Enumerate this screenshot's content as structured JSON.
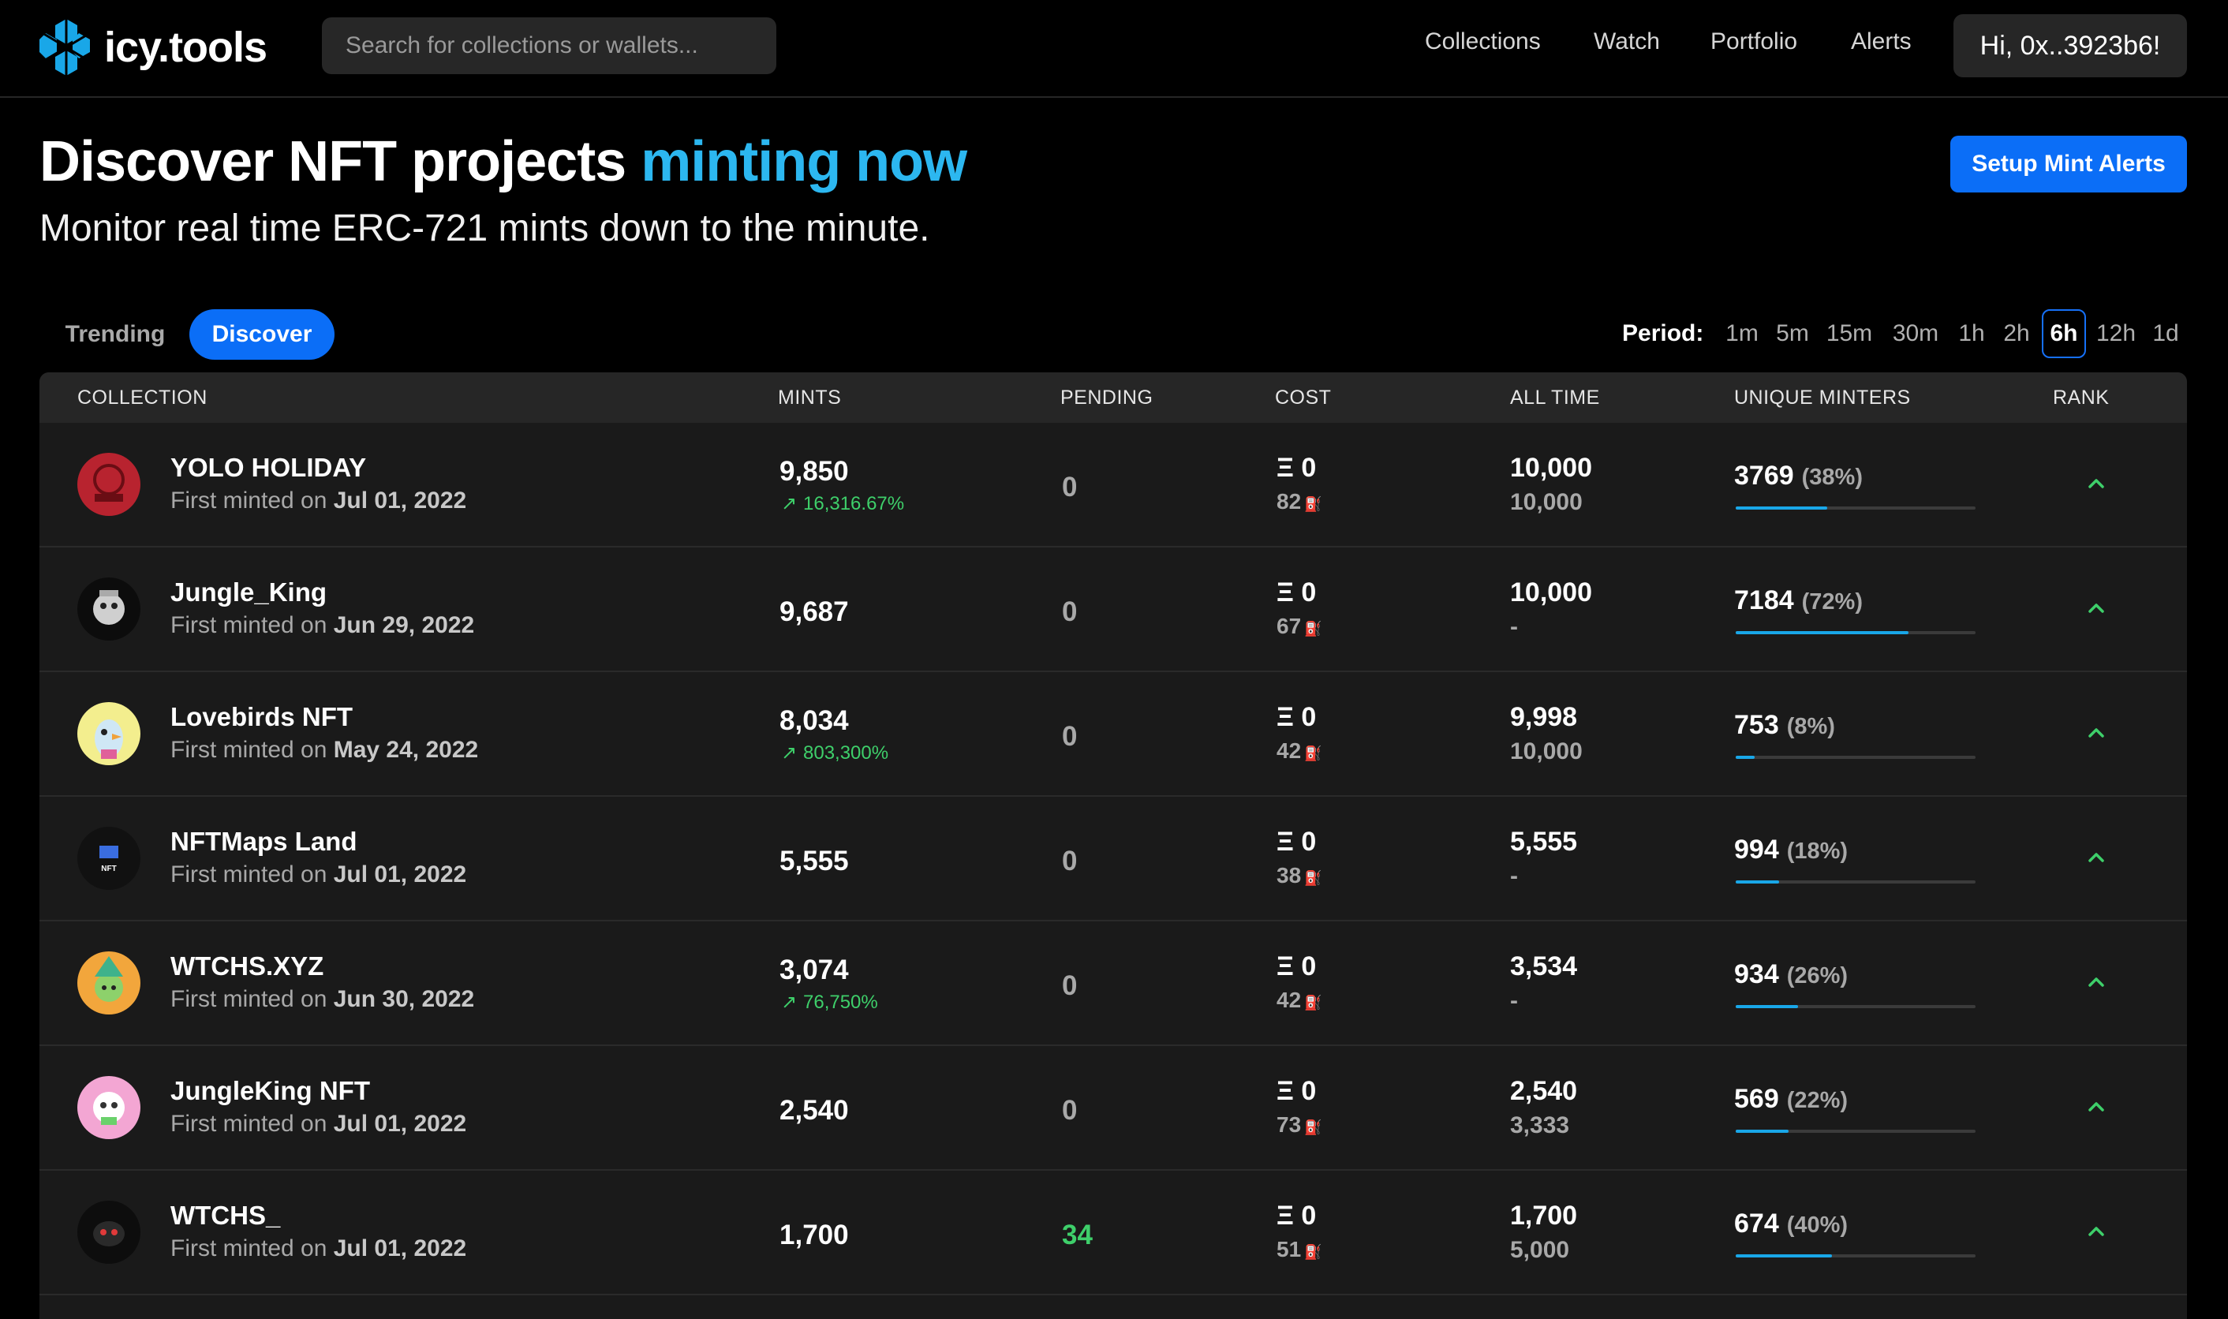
{
  "nav": {
    "logo_text": "icy.tools",
    "search_placeholder": "Search for collections or wallets...",
    "links": [
      "Collections",
      "Watch",
      "Portfolio",
      "Alerts"
    ],
    "account": "Hi, 0x..3923b6!"
  },
  "hero": {
    "title_start": "Discover NFT projects ",
    "title_accent": "minting now",
    "subtitle": "Monitor real time ERC-721 mints down to the minute.",
    "setup_button": "Setup Mint Alerts"
  },
  "tabs": {
    "trending": "Trending",
    "discover": "Discover"
  },
  "period": {
    "label": "Period:",
    "options": [
      "1m",
      "5m",
      "15m",
      "30m",
      "1h",
      "2h",
      "6h",
      "12h",
      "1d"
    ],
    "active": "6h"
  },
  "table": {
    "headers": [
      "COLLECTION",
      "MINTS",
      "PENDING",
      "COST",
      "ALL TIME",
      "UNIQUE MINTERS",
      "RANK"
    ],
    "first_minted_prefix": "First minted on ",
    "rows": [
      {
        "name": "YOLO HOLIDAY",
        "date": "Jul 01, 2022",
        "mints": "9,850",
        "change": "16,316.67%",
        "pending": "0",
        "cost": "Ξ 0",
        "gas": "82",
        "all_time": "10,000",
        "supply": "10,000",
        "minters": "3769",
        "minters_pct": "(38%)",
        "fill": 0.38,
        "avatar": "yolo"
      },
      {
        "name": "Jungle_King",
        "date": "Jun 29, 2022",
        "mints": "9,687",
        "change": "",
        "pending": "0",
        "cost": "Ξ 0",
        "gas": "67",
        "all_time": "10,000",
        "supply": "-",
        "minters": "7184",
        "minters_pct": "(72%)",
        "fill": 0.72,
        "avatar": "king"
      },
      {
        "name": "Lovebirds NFT",
        "date": "May 24, 2022",
        "mints": "8,034",
        "change": "803,300%",
        "pending": "0",
        "cost": "Ξ 0",
        "gas": "42",
        "all_time": "9,998",
        "supply": "10,000",
        "minters": "753",
        "minters_pct": "(8%)",
        "fill": 0.08,
        "avatar": "bird"
      },
      {
        "name": "NFTMaps Land",
        "date": "Jul 01, 2022",
        "mints": "5,555",
        "change": "",
        "pending": "0",
        "cost": "Ξ 0",
        "gas": "38",
        "all_time": "5,555",
        "supply": "-",
        "minters": "994",
        "minters_pct": "(18%)",
        "fill": 0.18,
        "avatar": "maps"
      },
      {
        "name": "WTCHS.XYZ",
        "date": "Jun 30, 2022",
        "mints": "3,074",
        "change": "76,750%",
        "pending": "0",
        "cost": "Ξ 0",
        "gas": "42",
        "all_time": "3,534",
        "supply": "-",
        "minters": "934",
        "minters_pct": "(26%)",
        "fill": 0.26,
        "avatar": "witch"
      },
      {
        "name": "JungleKing NFT",
        "date": "Jul 01, 2022",
        "mints": "2,540",
        "change": "",
        "pending": "0",
        "cost": "Ξ 0",
        "gas": "73",
        "all_time": "2,540",
        "supply": "3,333",
        "minters": "569",
        "minters_pct": "(22%)",
        "fill": 0.22,
        "avatar": "pink"
      },
      {
        "name": "WTCHS_",
        "date": "Jul 01, 2022",
        "mints": "1,700",
        "change": "",
        "pending": "34",
        "cost": "Ξ 0",
        "gas": "51",
        "all_time": "1,700",
        "supply": "5,000",
        "minters": "674",
        "minters_pct": "(40%)",
        "fill": 0.4,
        "avatar": "dark"
      }
    ]
  },
  "colors": {
    "accent_blue": "#0b6ef7",
    "title_accent": "#2cb7f0",
    "positive_green": "#3ecf6a",
    "bar_fill": "#19a7e8"
  }
}
